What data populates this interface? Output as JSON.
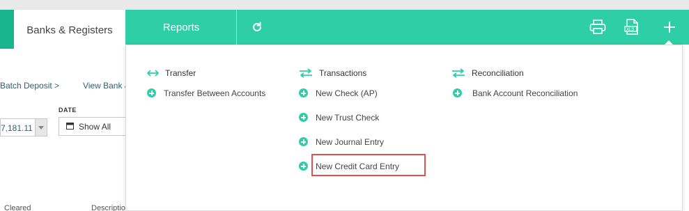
{
  "nav": {
    "tabs": [
      {
        "label": "Banks & Registers",
        "active": true
      },
      {
        "label": "Reports",
        "active": false
      }
    ],
    "icons": [
      "refresh-icon",
      "printer-icon",
      "xls-export-icon",
      "plus-icon"
    ],
    "accent_color": "#2ecfa6"
  },
  "background": {
    "batch_deposit_link": "Batch Deposit >",
    "view_bank_link": "View Bank &",
    "amount_value": "7,181.11",
    "date_label": "DATE",
    "date_value": "Show All",
    "table_headers": [
      "Cleared",
      "Description"
    ]
  },
  "menu": {
    "columns": [
      {
        "heading": "Transfer",
        "icon": "double-arrow-icon",
        "items": [
          "Transfer Between Accounts"
        ]
      },
      {
        "heading": "Transactions",
        "icon": "swap-arrows-icon",
        "items": [
          "New Check (AP)",
          "New Trust Check",
          "New Journal Entry",
          "New Credit Card Entry"
        ]
      },
      {
        "heading": "Reconciliation",
        "icon": "swap-arrows-icon",
        "items": [
          "Bank Account Reconciliation"
        ]
      }
    ],
    "highlighted_item": "New Credit Card Entry",
    "highlight_color": "#d9534f"
  }
}
